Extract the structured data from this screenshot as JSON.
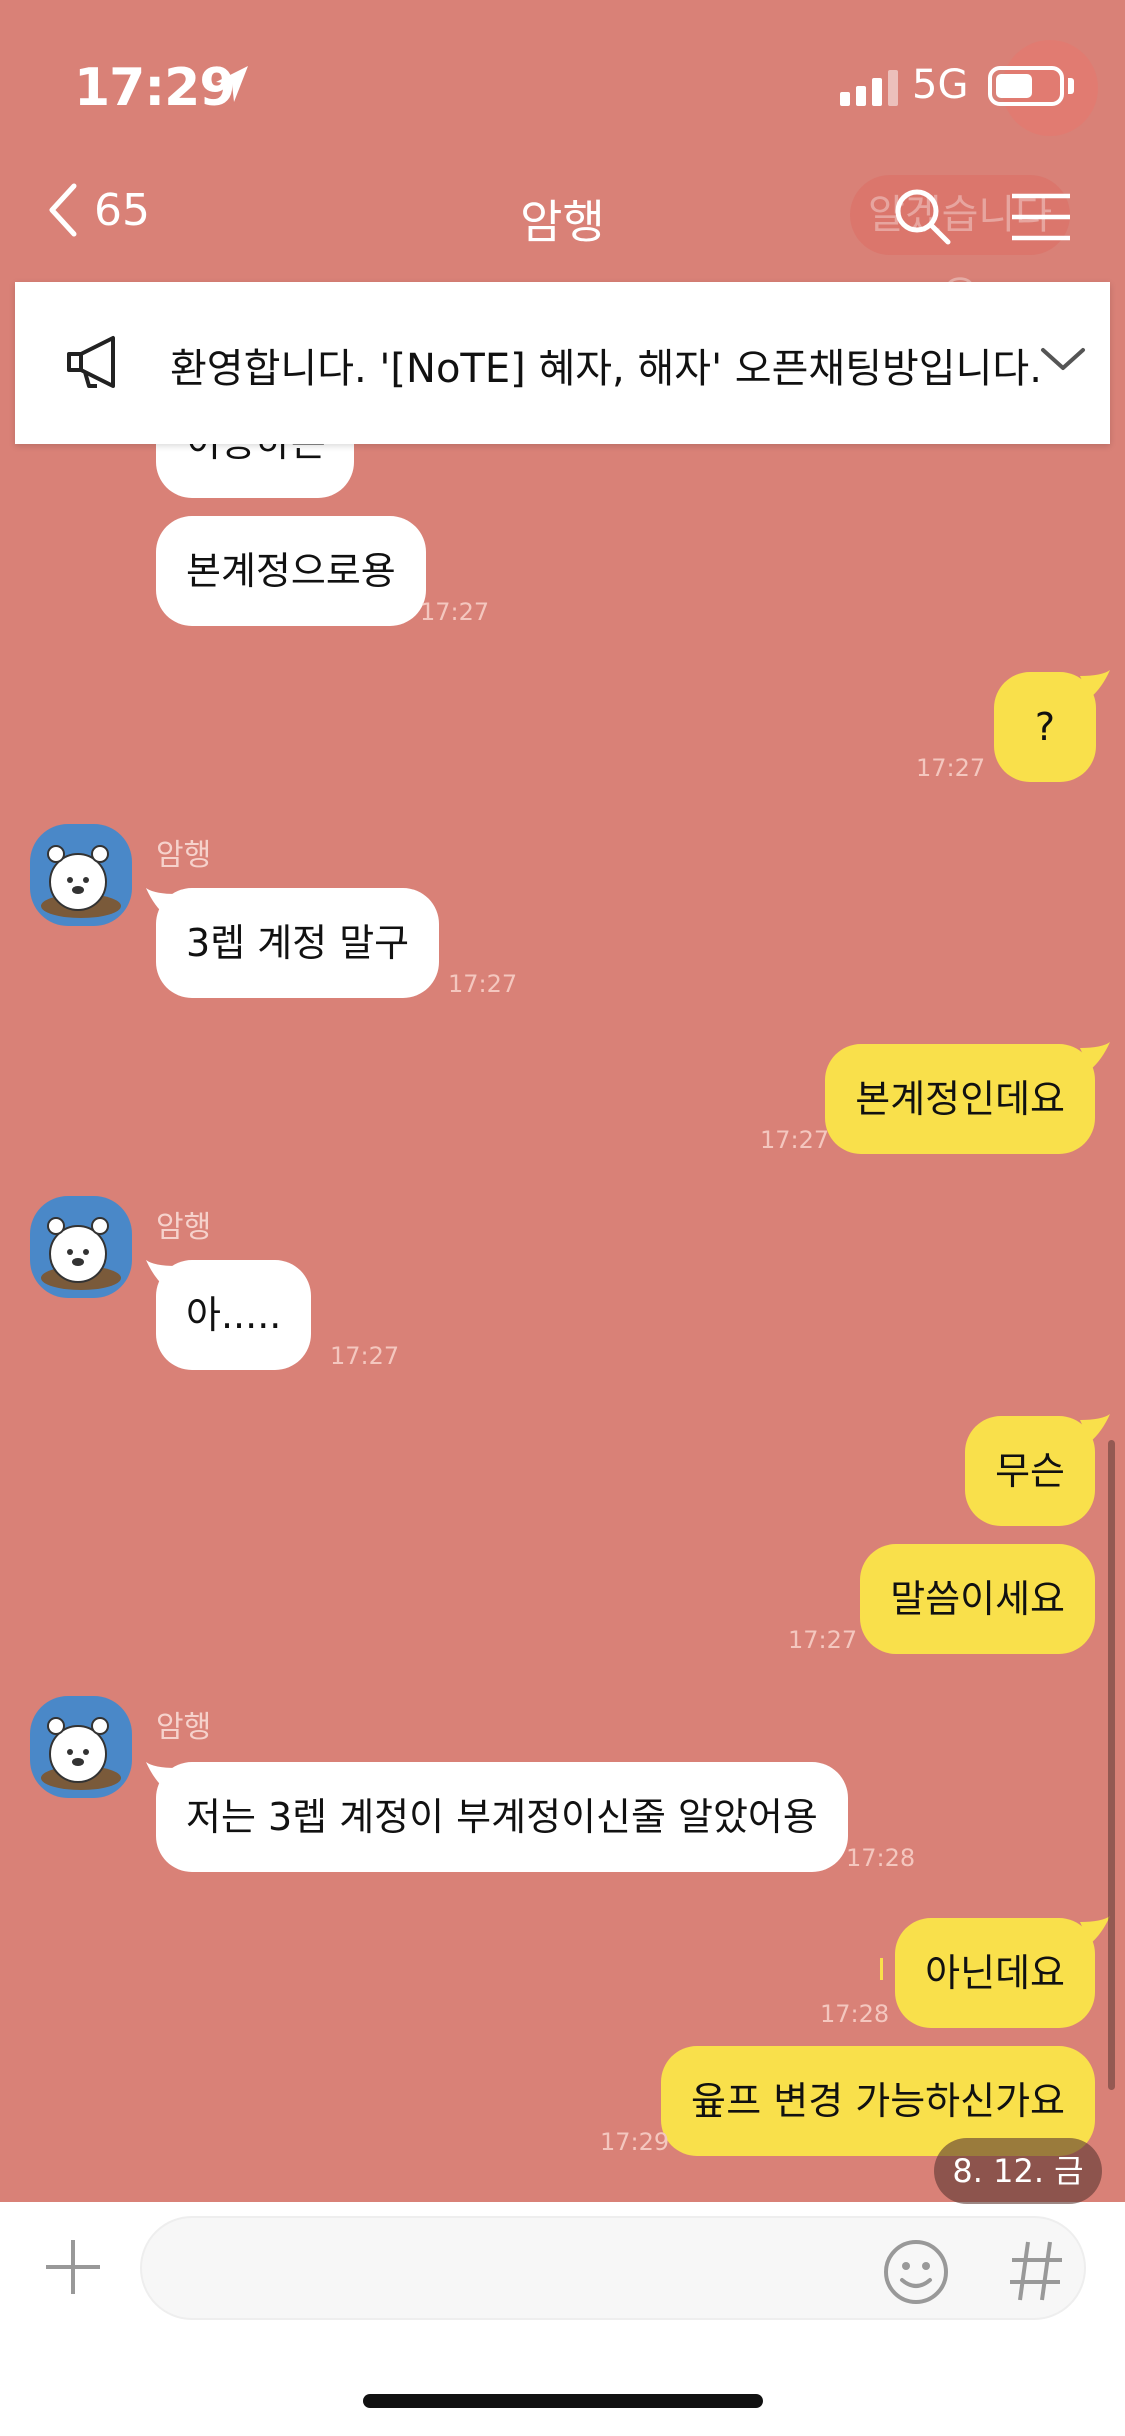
{
  "status": {
    "time": "17:29",
    "network": "5G"
  },
  "header": {
    "back_count": "65",
    "title": "암행",
    "ghost_text": "알겠습니다요"
  },
  "notice": {
    "text": "환영합니다. '[NoTE] 혜자, 해자' 오픈채팅방입니다."
  },
  "messages": [
    {
      "dir": "in",
      "text": "이용하는",
      "time": ""
    },
    {
      "dir": "in",
      "text": "본계정으로용",
      "time": "17:27"
    },
    {
      "dir": "out",
      "text": "?",
      "time": "17:27"
    },
    {
      "dir": "in",
      "sender": "암행",
      "text": "3렙 계정 말구",
      "time": "17:27"
    },
    {
      "dir": "out",
      "text": "본계정인데요",
      "time": "17:27"
    },
    {
      "dir": "in",
      "sender": "암행",
      "text": "아.....",
      "time": "17:27"
    },
    {
      "dir": "out",
      "text": "무슨",
      "time": ""
    },
    {
      "dir": "out",
      "text": "말씀이세요",
      "time": "17:27"
    },
    {
      "dir": "in",
      "sender": "암행",
      "text": "저는 3렙 계정이 부계정이신줄 알았어용",
      "time": "17:28"
    },
    {
      "dir": "out",
      "text": "아닌데요",
      "time": "17:28"
    },
    {
      "dir": "out",
      "text": "윺프 변경 가능하신가요",
      "time": "17:29"
    }
  ],
  "date_pill": "8. 12. 금",
  "colors": {
    "background": "#d98177",
    "outgoing": "#f9e04b",
    "incoming": "#ffffff"
  }
}
